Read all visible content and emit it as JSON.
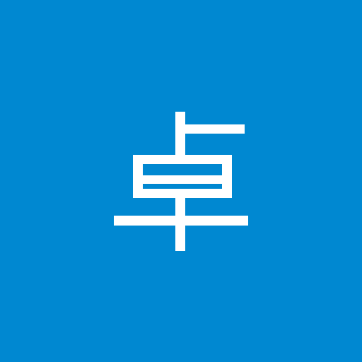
{
  "avatar": {
    "character": "卓",
    "background_color": "#0088d1",
    "glyph_color": "#ffffff"
  }
}
